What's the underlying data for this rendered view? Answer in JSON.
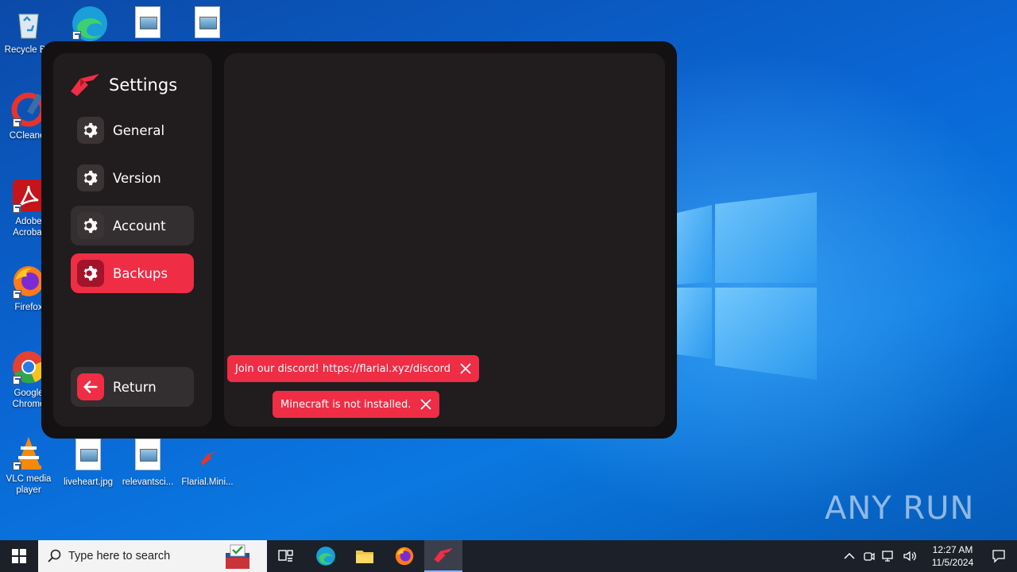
{
  "desktop": {
    "icons": [
      {
        "name": "recycle-bin",
        "label": "Recycle Bin"
      },
      {
        "name": "edge",
        "label": ""
      },
      {
        "name": "file-1",
        "label": ""
      },
      {
        "name": "file-2",
        "label": ""
      },
      {
        "name": "ccleaner",
        "label": "CCleaner"
      },
      {
        "name": "adobe-acrobat",
        "label": "Adobe Acrobat"
      },
      {
        "name": "firefox",
        "label": "Firefox"
      },
      {
        "name": "google-chrome",
        "label": "Google Chrome"
      },
      {
        "name": "vlc",
        "label": "VLC media player"
      },
      {
        "name": "liveheart",
        "label": "liveheart.jpg"
      },
      {
        "name": "relevantsci",
        "label": "relevantsci..."
      },
      {
        "name": "flarial-mini",
        "label": "Flarial.Mini..."
      }
    ]
  },
  "app": {
    "title": "Settings",
    "nav": [
      {
        "label": "General",
        "state": "normal"
      },
      {
        "label": "Version",
        "state": "normal"
      },
      {
        "label": "Account",
        "state": "hover"
      },
      {
        "label": "Backups",
        "state": "active"
      }
    ],
    "return_label": "Return",
    "toasts": [
      {
        "text": "Join our discord! https://flarial.xyz/discord"
      },
      {
        "text": "Minecraft is not installed."
      }
    ],
    "accent_color": "#ef2d45"
  },
  "taskbar": {
    "search_placeholder": "Type here to search",
    "clock_time": "12:27 AM",
    "clock_date": "11/5/2024"
  },
  "watermark": "ANY RUN"
}
